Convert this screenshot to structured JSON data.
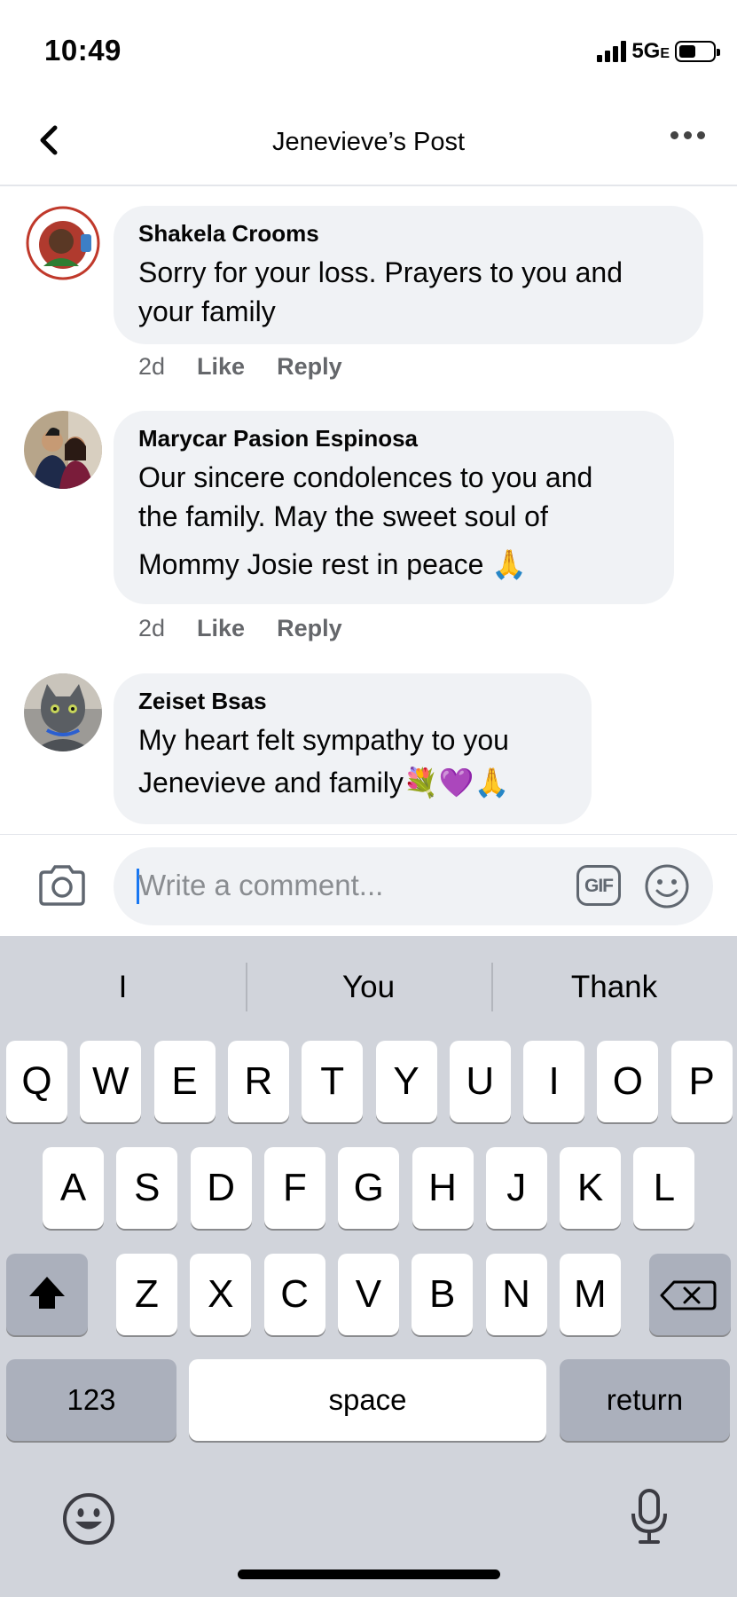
{
  "status_bar": {
    "time": "10:49",
    "network": "5G",
    "network_suffix": "E"
  },
  "nav": {
    "title": "Jenevieve’s Post"
  },
  "comments": [
    {
      "author": "Shakela Crooms",
      "line1": "Sorry for your loss. Prayers to you and",
      "line2": "your family",
      "time": "2d",
      "like": "Like",
      "reply": "Reply"
    },
    {
      "author": "Marycar Pasion Espinosa",
      "line1": "Our sincere condolences to you and",
      "line2": "the family. May the sweet soul of",
      "line3": "Mommy Josie rest in peace 🙏",
      "time": "2d",
      "like": "Like",
      "reply": "Reply"
    },
    {
      "author": "Zeiset Bsas",
      "line1": "My heart felt sympathy to you",
      "line2": "Jenevieve  and family💐💜🙏"
    }
  ],
  "composer": {
    "placeholder": "Write a comment...",
    "gif_label": "GIF"
  },
  "keyboard": {
    "suggestions": [
      "I",
      "You",
      "Thank"
    ],
    "row1": [
      "Q",
      "W",
      "E",
      "R",
      "T",
      "Y",
      "U",
      "I",
      "O",
      "P"
    ],
    "row2": [
      "A",
      "S",
      "D",
      "F",
      "G",
      "H",
      "J",
      "K",
      "L"
    ],
    "row3": [
      "Z",
      "X",
      "C",
      "V",
      "B",
      "N",
      "M"
    ],
    "numbers_label": "123",
    "space_label": "space",
    "return_label": "return"
  },
  "icons": {
    "back": "chevron-left-icon",
    "more": "more-dots-icon",
    "camera": "camera-icon",
    "emoji": "smiley-icon",
    "shift": "shift-arrow-icon",
    "delete": "backspace-icon",
    "keyboard_emoji": "emoji-face-icon",
    "mic": "microphone-icon"
  },
  "colors": {
    "bubble": "#f0f2f5",
    "meta": "#65676b",
    "keyboard_bg": "#d1d4db",
    "caret": "#1877f2"
  }
}
